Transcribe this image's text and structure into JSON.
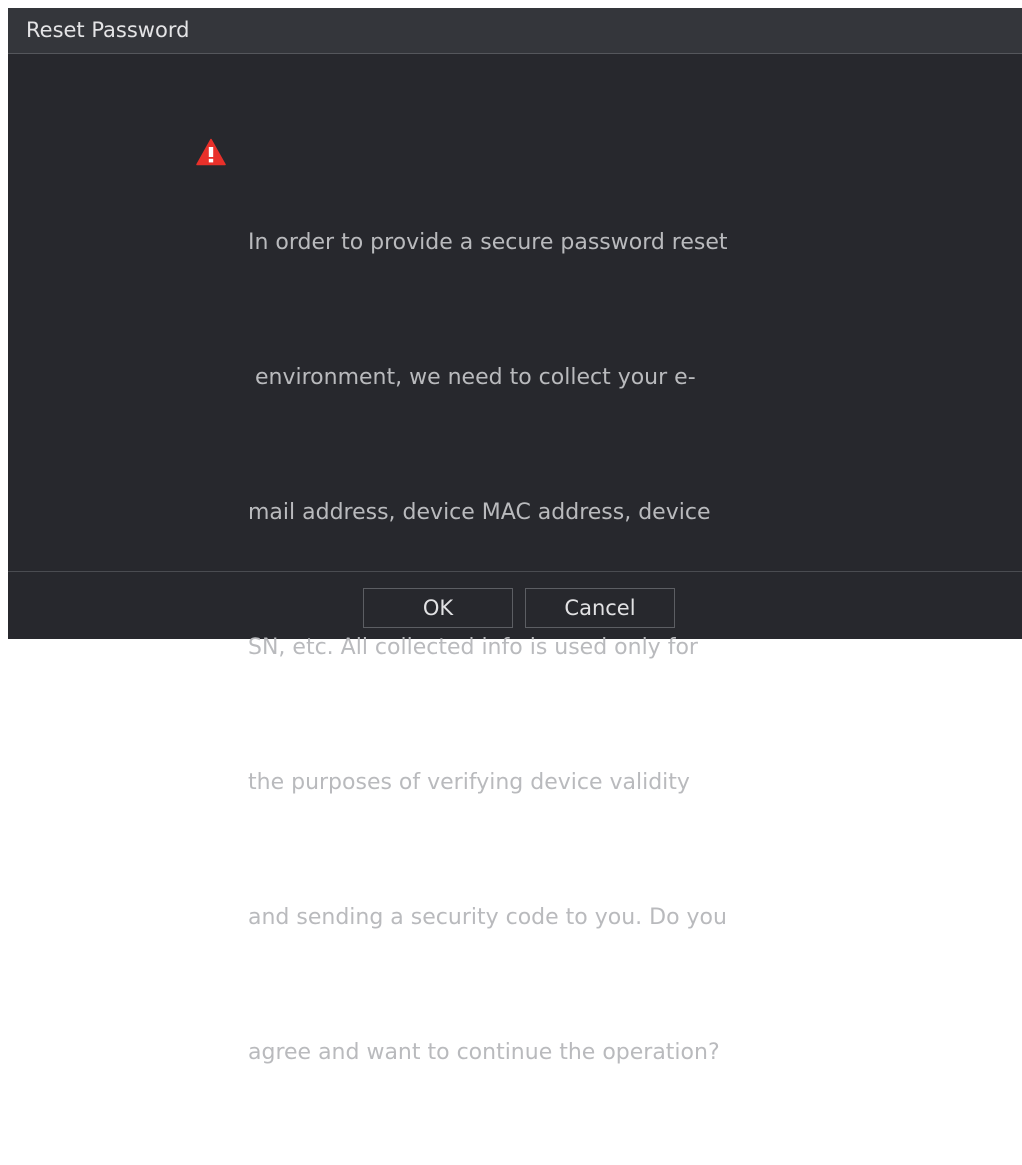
{
  "dialog": {
    "title": "Reset Password",
    "message_lines": [
      "In order to provide a secure password reset",
      " environment, we need to collect your e-",
      "mail address, device MAC address, device",
      "SN, etc. All collected info is used only for",
      "the purposes of verifying device validity",
      "and sending a security code to you. Do you",
      "agree and want to continue the operation?"
    ],
    "icon": "warning-icon",
    "buttons": {
      "ok_label": "OK",
      "cancel_label": "Cancel"
    }
  },
  "colors": {
    "background": "#27282d",
    "titlebar": "#34363b",
    "text": "#b9babd",
    "warning": "#e8302a"
  }
}
